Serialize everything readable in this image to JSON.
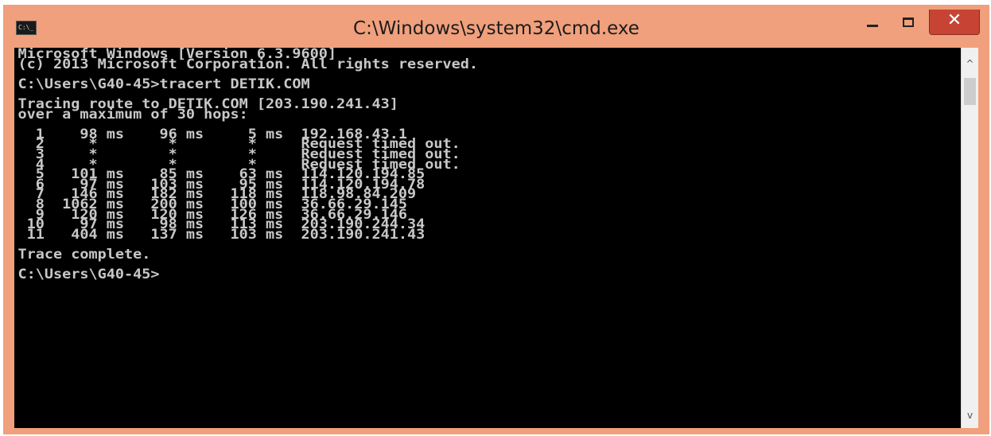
{
  "window": {
    "title": "C:\\Windows\\system32\\cmd.exe",
    "icon_label": "C:\\_",
    "minimize_glyph": "",
    "close_glyph": "✕"
  },
  "console": {
    "lines": [
      "Microsoft Windows [Version 6.3.9600]",
      "(c) 2013 Microsoft Corporation. All rights reserved.",
      "",
      "C:\\Users\\G40-45>tracert DETIK.COM",
      "",
      "Tracing route to DETIK.COM [203.190.241.43]",
      "over a maximum of 30 hops:",
      "",
      "  1    98 ms    96 ms     5 ms  192.168.43.1",
      "  2     *        *        *     Request timed out.",
      "  3     *        *        *     Request timed out.",
      "  4     *        *        *     Request timed out.",
      "  5   101 ms    85 ms    63 ms  114.120.194.85",
      "  6    97 ms   103 ms    95 ms  114.120.194.78",
      "  7   146 ms   182 ms   118 ms  118.98.84.209",
      "  8  1062 ms   200 ms   100 ms  36.66.29.145",
      "  9   120 ms   120 ms   126 ms  36.66.29.146",
      " 10    97 ms    98 ms   113 ms  203.190.244.34",
      " 11   404 ms   137 ms   103 ms  203.190.241.43",
      "",
      "Trace complete.",
      "",
      "C:\\Users\\G40-45>"
    ]
  },
  "scrollbar": {
    "up_glyph": "^",
    "down_glyph": "v"
  }
}
